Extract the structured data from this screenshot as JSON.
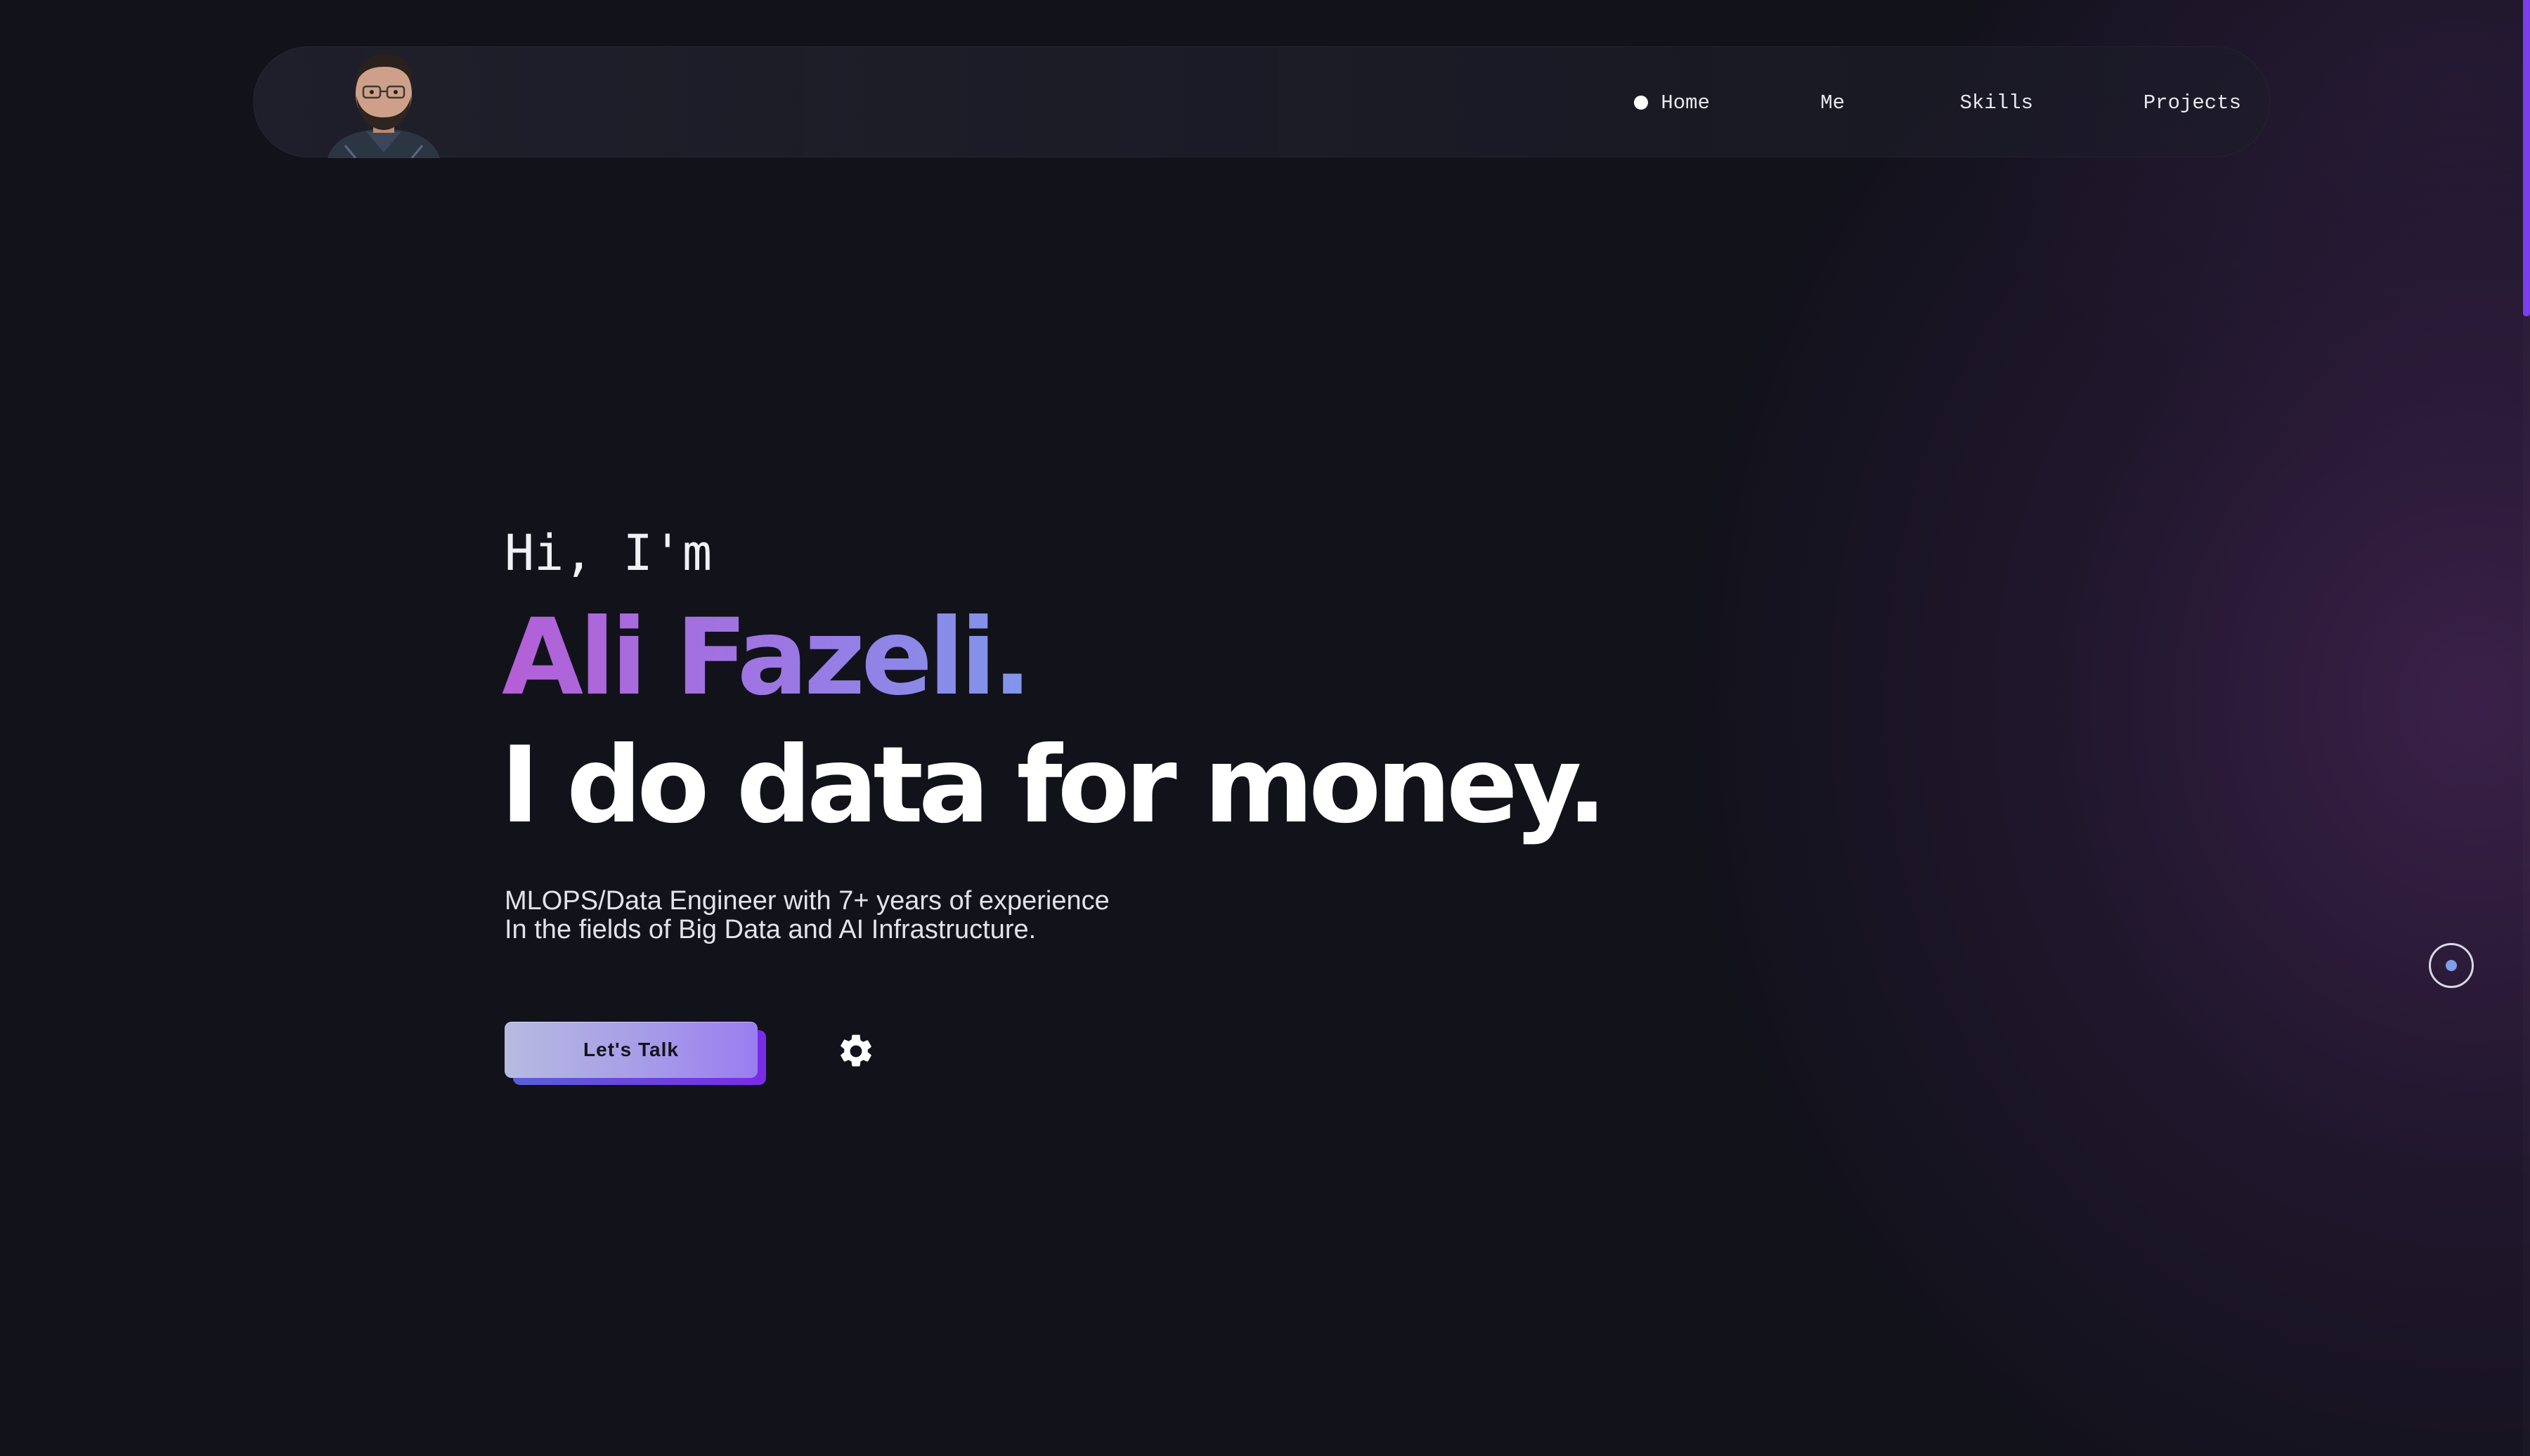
{
  "navbar": {
    "avatar_alt": "Profile photo",
    "items": [
      {
        "label": "Home",
        "active": true
      },
      {
        "label": "Me",
        "active": false
      },
      {
        "label": "Skills",
        "active": false
      },
      {
        "label": "Projects",
        "active": false
      }
    ]
  },
  "hero": {
    "greeting": "Hi, I'm",
    "name": "Ali Fazeli.",
    "tagline": "I do data for money.",
    "description_line1": "MLOPS/Data Engineer with 7+ years of experience",
    "description_line2": "In the fields of Big Data and AI Infrastructure.",
    "cta_label": "Let's Talk"
  },
  "icons": {
    "settings": "gear-icon",
    "cursor": "cursor-ring-icon"
  },
  "colors": {
    "background": "#12121b",
    "accent_purple": "#7b3df0",
    "name_gradient_start": "#b45fd6",
    "name_gradient_end": "#7f97ea",
    "cta_gradient_start": "#b7bbe0",
    "cta_gradient_end": "#9a7df0"
  }
}
